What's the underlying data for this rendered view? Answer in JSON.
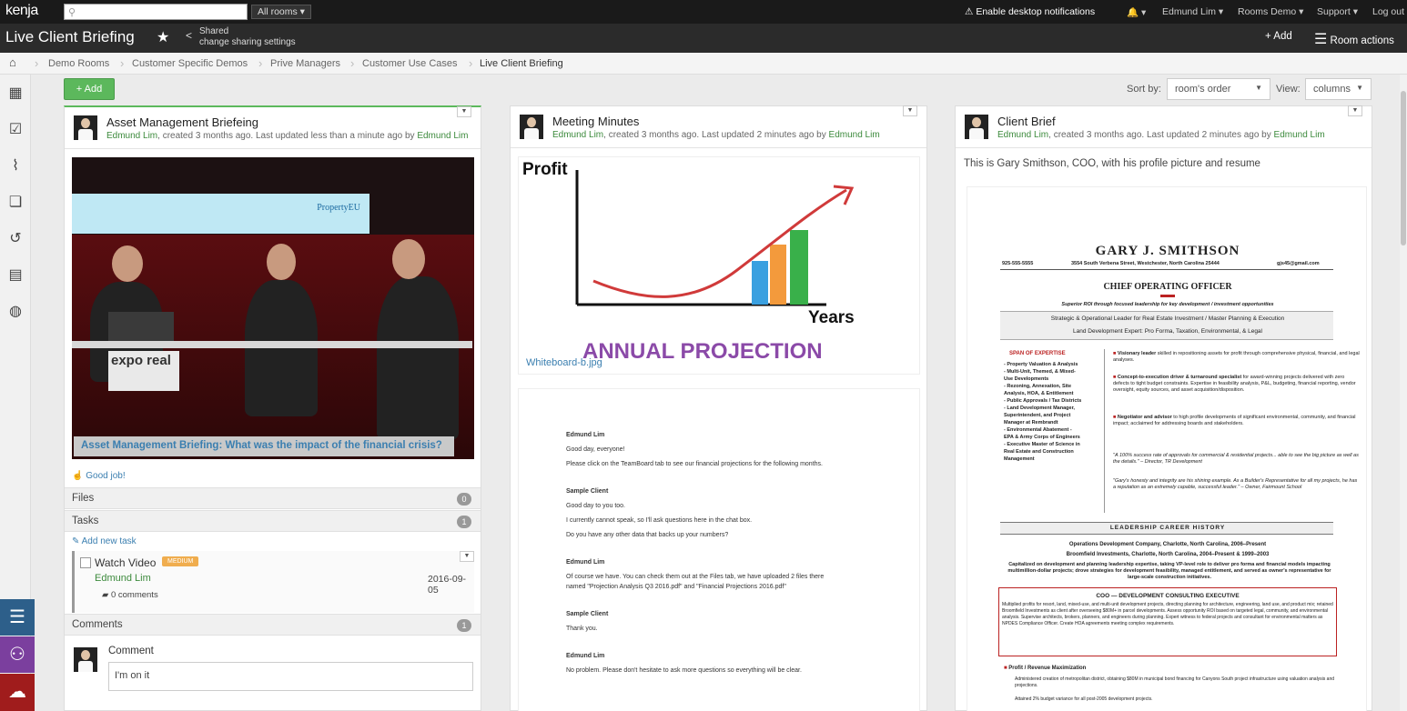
{
  "topbar": {
    "logo": "kenja",
    "search_placeholder": "",
    "all_rooms": "All rooms ▾",
    "notifications": "Enable desktop notifications",
    "bell": "🔔 ▾",
    "user": "Edmund Lim ▾",
    "rooms": "Rooms Demo ▾",
    "support": "Support ▾",
    "logout": "Log out"
  },
  "titlebar": {
    "title": "Live Client Briefing",
    "shared": "Shared",
    "change_sharing": "change sharing settings",
    "add": "+ Add",
    "room_actions": "Room actions"
  },
  "breadcrumbs": [
    "Demo Rooms",
    "Customer Specific Demos",
    "Prive Managers",
    "Customer Use Cases",
    "Live Client Briefing"
  ],
  "toolbar": {
    "add": "+ Add",
    "sort_label": "Sort by:",
    "sort_value": "room's order",
    "view_label": "View:",
    "view_value": "columns"
  },
  "cards": [
    {
      "title": "Asset Management Briefeing",
      "author": "Edmund Lim",
      "meta": ", created 3 months ago. Last updated less than a minute ago by ",
      "updater": "Edmund Lim",
      "video_banner": "PropertyEU",
      "video_logo": "expo real",
      "video_title": "Asset Management Briefing: What was the impact of the financial crisis?",
      "like": "Good job!",
      "sections": {
        "files": "Files",
        "files_count": "0",
        "tasks": "Tasks",
        "tasks_count": "1",
        "add_task": "Add new task",
        "comments": "Comments",
        "comments_count": "1"
      },
      "task": {
        "label": "Watch Video",
        "badge": "MEDIUM",
        "assignee": "Edmund Lim",
        "date": "2016-09-05",
        "comments": "0 comments"
      },
      "comment": {
        "label": "Comment",
        "value": "I'm on it"
      }
    },
    {
      "title": "Meeting Minutes",
      "author": "Edmund Lim",
      "meta": ", created 3 months ago. Last updated 2 minutes ago by ",
      "updater": "Edmund Lim",
      "whiteboard": {
        "profit": "Profit",
        "years": "Years",
        "projection": "ANNUAL PROJECTION",
        "filename": "Whiteboard-b.jpg"
      },
      "minutes": [
        {
          "speaker": "Edmund Lim",
          "lines": [
            "Good day, everyone!",
            "Please click on the TeamBoard tab to see our financial projections for the following months."
          ]
        },
        {
          "speaker": "Sample Client",
          "lines": [
            "Good day to you too.",
            "I currently cannot speak, so I'll ask questions here in the chat box.",
            "Do you have any other data that backs up your numbers?"
          ]
        },
        {
          "speaker": "Edmund Lim",
          "lines": [
            "Of course we have. You can check them out at the Files tab, we have uploaded 2 files there",
            "named \"Projection Analysis Q3 2016.pdf\" and \"Financial Projections 2016.pdf\""
          ]
        },
        {
          "speaker": "Sample Client",
          "lines": [
            "Thank you."
          ]
        },
        {
          "speaker": "Edmund Lim",
          "lines": [
            "No problem. Please don't hesitate to ask more questions so everything will be clear."
          ]
        }
      ]
    },
    {
      "title": "Client Brief",
      "author": "Edmund Lim",
      "meta": ", created 3 months ago. Last updated 2 minutes ago by ",
      "updater": "Edmund Lim",
      "description": "This is Gary Smithson, COO, with his profile picture and resume",
      "resume": {
        "name": "GARY J. SMITHSON",
        "phone": "925-555-5555",
        "address": "3554 South Verbena Street, Westchester, North Carolina 25444",
        "email": "gjs45@gmail.com",
        "role": "CHIEF OPERATING OFFICER",
        "tagline": "Superior ROI through focused leadership for key development / investment opportunities",
        "headline1": "Strategic & Operational Leader for Real Estate Investment / Master Planning & Execution",
        "headline2": "Land Development Expert: Pro Forma, Taxation, Environmental, & Legal",
        "expertise_title": "SPAN OF EXPERTISE",
        "expertise": [
          "- Property Valuation & Analysis",
          "- Multi-Unit, Themed, & Mixed-",
          "Use Developments",
          "- Rezoning, Annexation, Site",
          "Analysis, HOA, & Entitlement",
          "- Public Approvals / Tax Districts",
          "- Land Development Manager,",
          "Superintendent, and Project",
          "Manager at Rembrandt",
          "- Environmental Abatement -",
          "EPA & Army Corps of Engineers",
          "- Executive Master of Science in",
          "Real Estate and Construction",
          "Management"
        ],
        "bullets": [
          {
            "head": "Visionary leader",
            "text": "skilled in repositioning assets for profit through comprehensive physical, financial, and legal analyses."
          },
          {
            "head": "Concept-to-execution driver & turnaround specialist",
            "text": "for award-winning projects delivered with zero defects to tight budget constraints. Expertise in feasibility analysis, P&L, budgeting, financial reporting, vendor oversight, equity sources, and asset acquisition/disposition."
          },
          {
            "head": "Negotiator and advisor",
            "text": "to high profile developments of significant environmental, community, and financial impact; acclaimed for addressing boards and stakeholders."
          }
        ],
        "quote1": "\"A 100% success rate of approvals for commercial & residential projects... able to see the big picture as well as the details.\" – Director, TR Development",
        "quote2": "\"Gary's honesty and integrity are his shining example. As a Builder's Representative for all my projects, he has a reputation as an extremely capable, successful leader.\" – Owner, Fairmount School",
        "history_title": "LEADERSHIP CAREER HISTORY",
        "job1": "Operations Development Company, Charlotte, North Carolina, 2006–Present",
        "job2": "Broomfield Investments, Charlotte, North Carolina, 2004–Present & 1999–2003",
        "summary": "Capitalized on development and planning leadership expertise, taking VP-level role to deliver pro forma and financial models impacting multimillion-dollar projects; drove strategies for development feasibility, managed entitlement, and served as owner's representative for large-scale construction initiatives.",
        "coo_title": "COO — DEVELOPMENT CONSULTING EXECUTIVE",
        "coo_text": "Multiplied profits for resort, land, mixed-use, and multi-unit development projects, directing planning for architecture, engineering, land use, and product mix; retained Broomfield Investments as client after overseeing $80M+ in parcel developments. Assess opportunity ROI based on targeted legal, community, and environmental analysis. Supervise architects, brokers, planners, and engineers during planning. Expert witness to federal projects and consultant for environmental matters as NPDES Compliance Officer. Create HOA agreements meeting complex requirements.",
        "profit_title": "Profit / Revenue Maximization",
        "profit_b1": "Administered creation of metropolitan district, obtaining $80M in municipal bond financing for Canyons South project infrastructure using valuation analysis and projections.",
        "profit_b2": "Attained 2% budget variance for all post-2005 development projects."
      }
    }
  ]
}
